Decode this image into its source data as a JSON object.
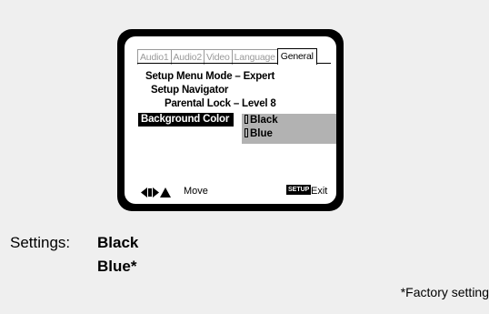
{
  "tabs": [
    "Audio1",
    "Audio2",
    "Video",
    "Language",
    "General"
  ],
  "active_tab": "General",
  "menu": {
    "setup_menu_mode": "Setup Menu Mode – Expert",
    "setup_navigator": "Setup Navigator",
    "parental_lock": "Parental Lock – Level 8",
    "background_color_label": "Background Color",
    "options": [
      "Black",
      "Blue"
    ]
  },
  "footer": {
    "move_icon": "arrow-keys-icon",
    "move_label": "Move",
    "setup_key": "SETUP",
    "exit_label": "Exit"
  },
  "settings": {
    "label": "Settings:",
    "values": [
      "Black",
      "Blue*"
    ]
  },
  "factory_note": "*Factory setting",
  "colors": {
    "page_bg": "#efefef",
    "tv_frame": "#000000",
    "option_highlight": "#b2b2b2"
  }
}
